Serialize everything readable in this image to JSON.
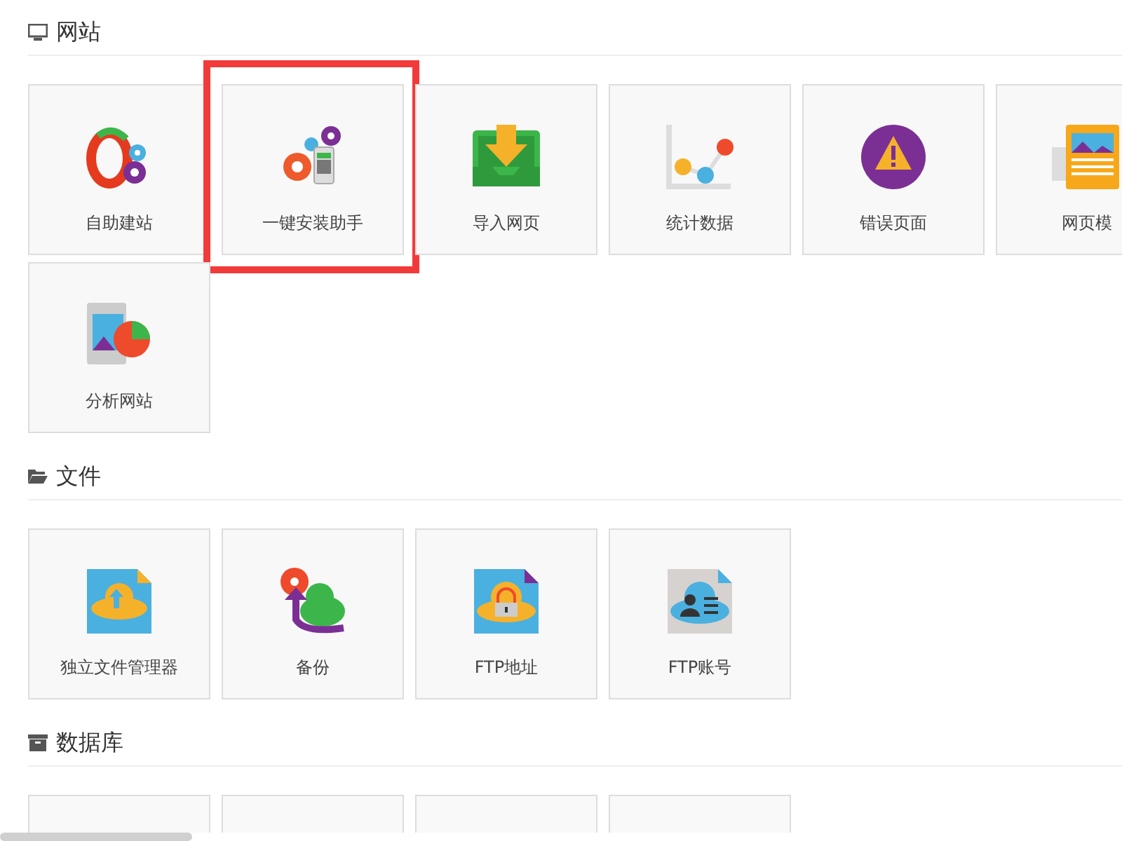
{
  "sections": [
    {
      "title": "网站",
      "kind": "monitor",
      "tiles": [
        {
          "label": "自助建站",
          "kind": "site-builder",
          "highlighted": false
        },
        {
          "label": "一键安装助手",
          "kind": "installer",
          "highlighted": true
        },
        {
          "label": "导入网页",
          "kind": "import",
          "highlighted": false
        },
        {
          "label": "统计数据",
          "kind": "stats",
          "highlighted": false
        },
        {
          "label": "错误页面",
          "kind": "error",
          "highlighted": false
        },
        {
          "label": "网页模",
          "kind": "template",
          "highlighted": false
        },
        {
          "label": "分析网站",
          "kind": "analysis",
          "highlighted": false
        }
      ]
    },
    {
      "title": "文件",
      "kind": "folder",
      "tiles": [
        {
          "label": "独立文件管理器",
          "kind": "file-manager",
          "highlighted": false
        },
        {
          "label": "备份",
          "kind": "backup",
          "highlighted": false
        },
        {
          "label": "FTP地址",
          "kind": "ftp-address",
          "highlighted": false
        },
        {
          "label": "FTP账号",
          "kind": "ftp-account",
          "highlighted": false
        }
      ]
    },
    {
      "title": "数据库",
      "kind": "archive",
      "tiles": [
        {
          "kind": "blank"
        },
        {
          "kind": "blank"
        },
        {
          "kind": "blank"
        },
        {
          "kind": "blank"
        }
      ]
    }
  ]
}
